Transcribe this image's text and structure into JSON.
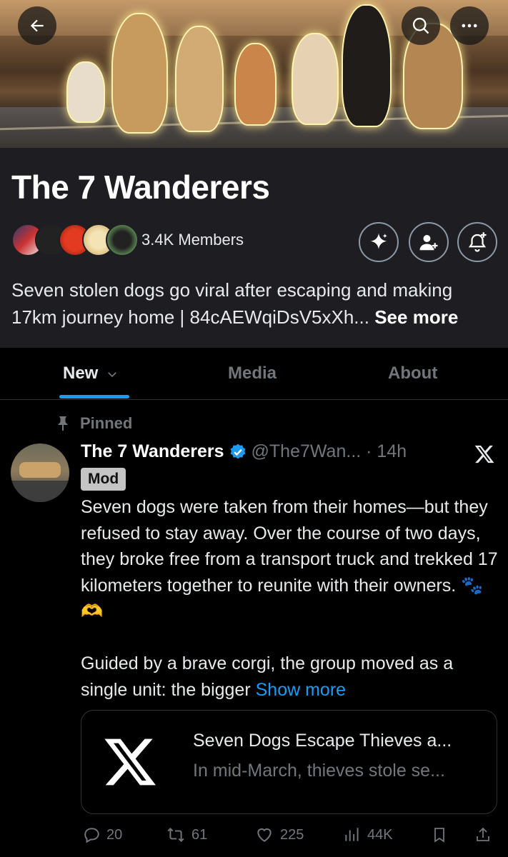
{
  "community": {
    "name": "The 7 Wanderers",
    "members": "3.4K Members",
    "description": "Seven stolen dogs go viral after escaping and making 17km journey home | 84cAEWqiDsV5xXh...",
    "see_more": "See more"
  },
  "tabs": [
    {
      "label": "New"
    },
    {
      "label": "Media"
    },
    {
      "label": "About"
    }
  ],
  "post": {
    "pinned_label": "Pinned",
    "author_name": "The 7 Wanderers",
    "handle_time": "@The7Wan... · 14h",
    "badge": "Mod",
    "paragraph1": "Seven dogs were taken from their homes—but they refused to stay away. Over the course of two days, they broke free from a transport truck and trekked 17 kilometers together to reunite with their owners. 🐾🫶",
    "paragraph2": "Guided by a brave corgi, the group moved as a single unit: the bigger",
    "show_more": "Show more",
    "card": {
      "title": "Seven Dogs Escape Thieves a...",
      "subtitle": "In mid-March, thieves stole se..."
    },
    "stats": {
      "replies": "20",
      "reposts": "61",
      "likes": "225",
      "views": "44K"
    }
  },
  "colors": {
    "accent": "#1d9bf0",
    "verified": "#1d9bf0",
    "muted": "#71767b",
    "header_bg": "#1e1e22"
  },
  "icons": [
    "back-arrow-icon",
    "search-icon",
    "more-icon",
    "sparkle-icon",
    "add-user-icon",
    "add-notification-icon",
    "chevron-down-icon",
    "pin-icon",
    "verified-icon",
    "x-logo-icon",
    "reply-icon",
    "repost-icon",
    "like-icon",
    "views-icon",
    "bookmark-icon",
    "share-icon"
  ]
}
